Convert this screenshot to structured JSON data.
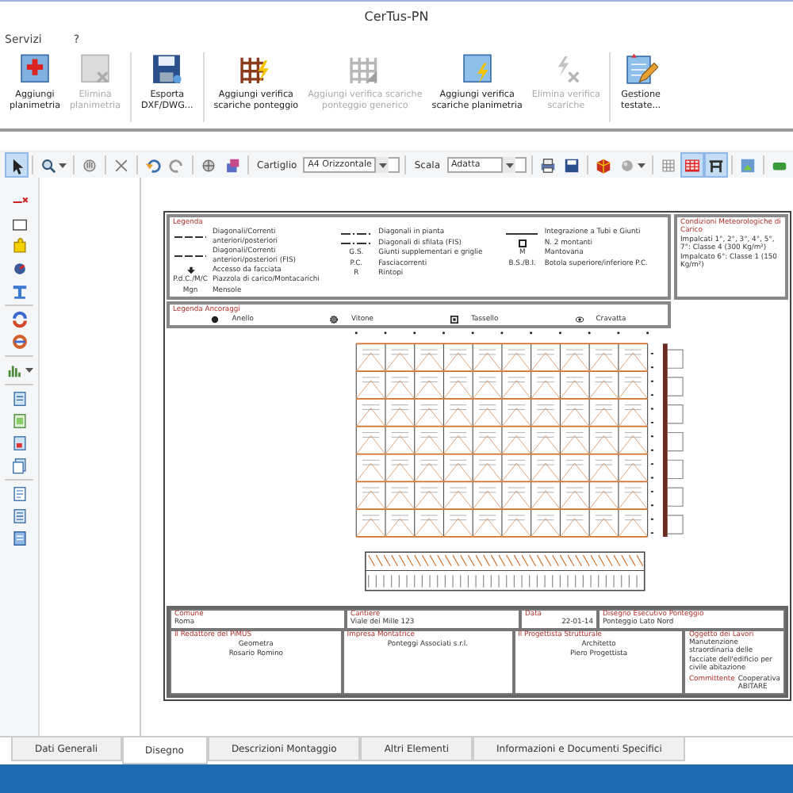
{
  "window": {
    "title": "CerTus-PN"
  },
  "menu": [
    "Servizi",
    "?"
  ],
  "ribbon": [
    {
      "lines": [
        "Aggiungi",
        "planimetria"
      ],
      "disabled": false
    },
    {
      "lines": [
        "Elimina",
        "planimetria"
      ],
      "disabled": true
    },
    {
      "lines": [
        "Esporta",
        "DXF/DWG..."
      ],
      "disabled": false
    },
    {
      "lines": [
        "Aggiungi verifica",
        "scariche ponteggio"
      ],
      "disabled": false
    },
    {
      "lines": [
        "Aggiungi verifica scariche",
        "ponteggio generico"
      ],
      "disabled": true
    },
    {
      "lines": [
        "Aggiungi verifica",
        "scariche planimetria"
      ],
      "disabled": false
    },
    {
      "lines": [
        "Elimina verifica",
        "scariche"
      ],
      "disabled": true
    },
    {
      "lines": [
        "Gestione",
        "testate..."
      ],
      "disabled": false
    }
  ],
  "toolbar": [
    {
      "kind": "icon",
      "selected": true,
      "dropdown": false
    },
    {
      "kind": "sep"
    },
    {
      "kind": "icon",
      "selected": false,
      "dropdown": true
    },
    {
      "kind": "sep"
    },
    {
      "kind": "icon",
      "selected": false,
      "dropdown": false
    },
    {
      "kind": "sep"
    },
    {
      "kind": "icon",
      "selected": false,
      "dropdown": false
    },
    {
      "kind": "sep"
    },
    {
      "kind": "icon",
      "selected": false,
      "dropdown": false
    },
    {
      "kind": "icon",
      "selected": false,
      "dropdown": false
    },
    {
      "kind": "sep"
    },
    {
      "kind": "icon",
      "selected": false,
      "dropdown": false
    },
    {
      "kind": "icon",
      "selected": false,
      "dropdown": false
    },
    {
      "kind": "sep"
    },
    {
      "kind": "label",
      "text": "Cartiglio"
    },
    {
      "kind": "select",
      "value": "A4 Orizzontale"
    },
    {
      "kind": "sep"
    },
    {
      "kind": "label",
      "text": "Scala"
    },
    {
      "kind": "select",
      "value": "Adatta"
    },
    {
      "kind": "sep"
    },
    {
      "kind": "icon",
      "selected": false,
      "dropdown": false
    },
    {
      "kind": "icon",
      "selected": false,
      "dropdown": false
    },
    {
      "kind": "sep"
    },
    {
      "kind": "icon",
      "selected": false,
      "dropdown": false
    },
    {
      "kind": "icon",
      "selected": false,
      "dropdown": true
    },
    {
      "kind": "sep"
    },
    {
      "kind": "icon",
      "selected": false,
      "dropdown": false
    },
    {
      "kind": "icon",
      "selected": true,
      "dropdown": false
    },
    {
      "kind": "icon",
      "selected": true,
      "dropdown": false
    },
    {
      "kind": "sep"
    },
    {
      "kind": "icon",
      "selected": false,
      "dropdown": false
    },
    {
      "kind": "sep"
    },
    {
      "kind": "icon",
      "selected": false,
      "dropdown": false
    }
  ],
  "left_tools": [
    {
      "kind": "icon",
      "dropdown": false
    },
    {
      "kind": "icon",
      "dropdown": false
    },
    {
      "kind": "icon",
      "dropdown": false
    },
    {
      "kind": "icon",
      "dropdown": false
    },
    {
      "kind": "icon",
      "dropdown": false
    },
    {
      "kind": "sep"
    },
    {
      "kind": "icon",
      "dropdown": false
    },
    {
      "kind": "icon",
      "dropdown": false
    },
    {
      "kind": "sep"
    },
    {
      "kind": "icon",
      "dropdown": true
    },
    {
      "kind": "sep"
    },
    {
      "kind": "icon",
      "dropdown": false
    },
    {
      "kind": "icon",
      "dropdown": false
    },
    {
      "kind": "icon",
      "dropdown": false
    },
    {
      "kind": "icon",
      "dropdown": false
    },
    {
      "kind": "sep"
    },
    {
      "kind": "icon",
      "dropdown": false
    },
    {
      "kind": "icon",
      "dropdown": false
    },
    {
      "kind": "icon",
      "dropdown": false
    }
  ],
  "sheet": {
    "legend": {
      "title": "Legenda",
      "columns": [
        [
          {
            "kind": "dash",
            "text": "Diagonali/Correnti anteriori/posteriori"
          },
          {
            "kind": "dash",
            "text": "Diagonali/Correnti anteriori/posteriori (FIS)"
          },
          {
            "kind": "arrow",
            "text": "Accesso da facciata"
          },
          {
            "kind": "code",
            "symbol": "P.d.C./M/C",
            "text": "Piazzola di carico/Montacarichi"
          },
          {
            "kind": "code",
            "symbol": "Mgn",
            "text": "Mensole"
          }
        ],
        [
          {
            "kind": "dashdot",
            "text": "Diagonali in pianta"
          },
          {
            "kind": "dashdot",
            "text": "Diagonali di sfilata (FIS)"
          },
          {
            "kind": "code",
            "symbol": "G.S.",
            "text": "Giunti supplementari e griglie"
          },
          {
            "kind": "code",
            "symbol": "P.C.",
            "text": "Fasciacorrenti"
          },
          {
            "kind": "code",
            "symbol": "R",
            "text": "Rintopi"
          }
        ],
        [
          {
            "kind": "line",
            "text": "Integrazione a Tubi e Giunti"
          },
          {
            "kind": "square",
            "text": "N. 2 montanti"
          },
          {
            "kind": "code",
            "symbol": "M",
            "text": "Mantovana"
          },
          {
            "kind": "code",
            "symbol": "B.S./B.I.",
            "text": "Botola superiore/inferiore P.C."
          }
        ]
      ]
    },
    "loads": {
      "title": "Condizioni Meteorologiche di Carico",
      "lines": [
        "Impalcati 1°, 2°, 3°, 4°, 5°, 7°: Classe 4 (300 Kg/m²)",
        "Impalcato 6°: Classe 1 (150 Kg/m²)"
      ]
    },
    "anchors": {
      "title": "Legenda Ancoraggi",
      "items": [
        {
          "kind": "dot",
          "text": "Anello"
        },
        {
          "kind": "gear",
          "text": "Vitone"
        },
        {
          "kind": "square",
          "text": "Tassello"
        },
        {
          "kind": "eye",
          "text": "Cravatta"
        }
      ]
    },
    "info_top": [
      {
        "label": "Comune",
        "value": "Roma"
      },
      {
        "label": "Cantiere",
        "value": "Viale dei Mille 123"
      },
      {
        "label": "Data",
        "value": "22-01-14"
      },
      {
        "label": "Disegno Esecutivo Ponteggio",
        "value": "Ponteggio Lato Nord"
      }
    ],
    "info_bottom": [
      {
        "label": "Il Redattore del PiMUS",
        "lines": [
          "Geometra",
          "Rosario Romino"
        ]
      },
      {
        "label": "Impresa Montatrice",
        "lines": [
          "Ponteggi Associati s.r.l."
        ]
      },
      {
        "label": "Il Progettista Strutturale",
        "lines": [
          "Architetto",
          "Piero Progettista"
        ]
      }
    ],
    "works": {
      "label": "Oggetto dei Lavori",
      "text": "Manutenzione straordinaria delle facciate dell'edificio per civile abitazione",
      "client_label": "Committente",
      "client": "Cooperativa ABITARE"
    }
  },
  "tabs": [
    {
      "label": "Dati Generali",
      "selected": false
    },
    {
      "label": "Disegno",
      "selected": true
    },
    {
      "label": "Descrizioni Montaggio",
      "selected": false
    },
    {
      "label": "Altri Elementi",
      "selected": false
    },
    {
      "label": "Informazioni e Documenti Specifici",
      "selected": false
    }
  ]
}
